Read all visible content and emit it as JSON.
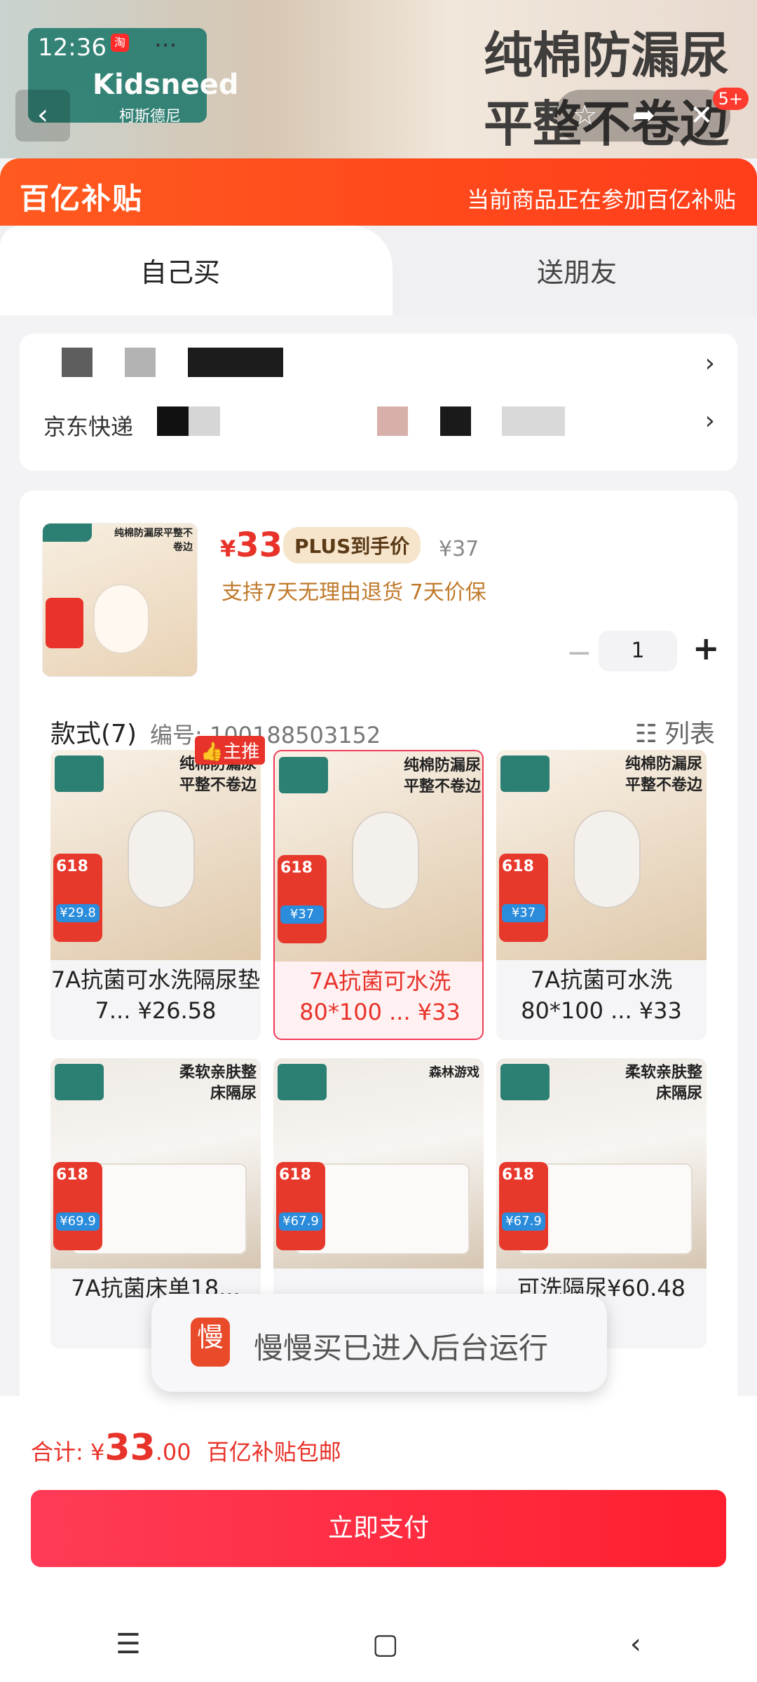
{
  "status": {
    "time": "12:36",
    "dots": "···",
    "badge": "淘",
    "notif_count": "5+"
  },
  "background": {
    "logo_main": "Kidsneed",
    "logo_sub": "柯斯德尼",
    "title_line1": "纯棉防漏尿",
    "title_line2": "平整不卷边"
  },
  "banner": {
    "brand": "百亿补贴",
    "message": "当前商品正在参加百亿补贴"
  },
  "tabs": {
    "self": "自己买",
    "gift": "送朋友"
  },
  "address": {
    "express_label": "京东快递"
  },
  "product": {
    "thumb_title": "纯棉防漏尿平整不卷边",
    "price_currency": "¥",
    "price": "33",
    "plus_label": "PLUS到手价",
    "original_price": "¥37",
    "service": "支持7天无理由退货  7天价保",
    "quantity": "1"
  },
  "spec": {
    "title": "款式(7)",
    "number": "编号: 100188503152",
    "list_label": "列表",
    "hot_label": "主推"
  },
  "items": [
    {
      "title": "纯棉防漏尿平整不卷边",
      "promo": "618",
      "price_tag": "¥29.8",
      "caption": "7A抗菌可水洗隔尿垫7... ¥26.58"
    },
    {
      "title": "纯棉防漏尿平整不卷边",
      "promo": "618",
      "price_tag": "¥37",
      "caption": "7A抗菌可水洗80*100 ... ¥33"
    },
    {
      "title": "纯棉防漏尿平整不卷边",
      "promo": "618",
      "price_tag": "¥37",
      "caption": "7A抗菌可水洗80*100 ... ¥33"
    },
    {
      "title": "柔软亲肤整床隔尿",
      "promo": "618",
      "price_tag": "¥69.9",
      "caption": "7A抗菌床单18..."
    },
    {
      "title": "森林游戏",
      "promo": "618",
      "price_tag": "¥67.9",
      "caption": ""
    },
    {
      "title": "柔软亲肤整床隔尿",
      "promo": "618",
      "price_tag": "¥67.9",
      "caption": "可洗隔尿¥60.48"
    }
  ],
  "toast": {
    "icon": "慢",
    "text": "慢慢买已进入后台运行"
  },
  "footer": {
    "total_label": "合计: ¥",
    "total_int": "33",
    "total_dec": ".00",
    "subsidy": "百亿补贴包邮",
    "pay_button": "立即支付"
  },
  "navbar": {
    "menu": "☰",
    "home": "▢",
    "back": "‹"
  }
}
